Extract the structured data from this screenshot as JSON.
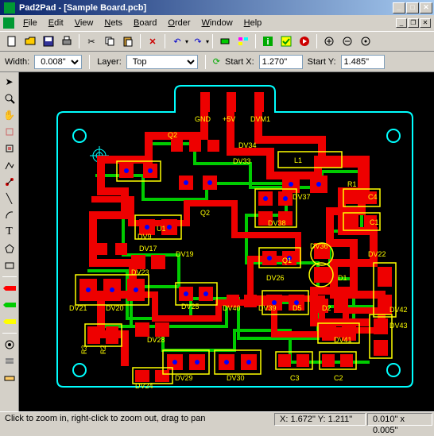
{
  "title": "Pad2Pad - [Sample Board.pcb]",
  "menus": [
    "File",
    "Edit",
    "View",
    "Nets",
    "Board",
    "Order",
    "Window",
    "Help"
  ],
  "props": {
    "widthLabel": "Width:",
    "widthValue": "0.008\"",
    "layerLabel": "Layer:",
    "layerValue": "Top",
    "startXLabel": "Start X:",
    "startXValue": "1.270\"",
    "startYLabel": "Start Y:",
    "startYValue": "1.485\""
  },
  "status": {
    "hint": "Click to zoom in, right-click to zoom out, drag to pan",
    "coords": "X: 1.672\" Y: 1.211\"",
    "grid": "0.010\" x 0.005\""
  },
  "board_labels": [
    "GND",
    "+5V",
    "DVM1",
    "DV34",
    "DV33",
    "L1",
    "Q2",
    "DV37",
    "R1",
    "C4",
    "U1",
    "DV9",
    "DV38",
    "C1",
    "DV17",
    "DV19",
    "DV36",
    "DV22",
    "DV23",
    "Q1",
    "DV21",
    "DV20",
    "DV26",
    "D1",
    "DV25",
    "DV40",
    "DV39",
    "D5",
    "D2",
    "DV42",
    "DV43",
    "R3",
    "R2",
    "DV28",
    "DV41",
    "DV24",
    "DV29",
    "DV30",
    "C3",
    "C2",
    "Q2"
  ]
}
